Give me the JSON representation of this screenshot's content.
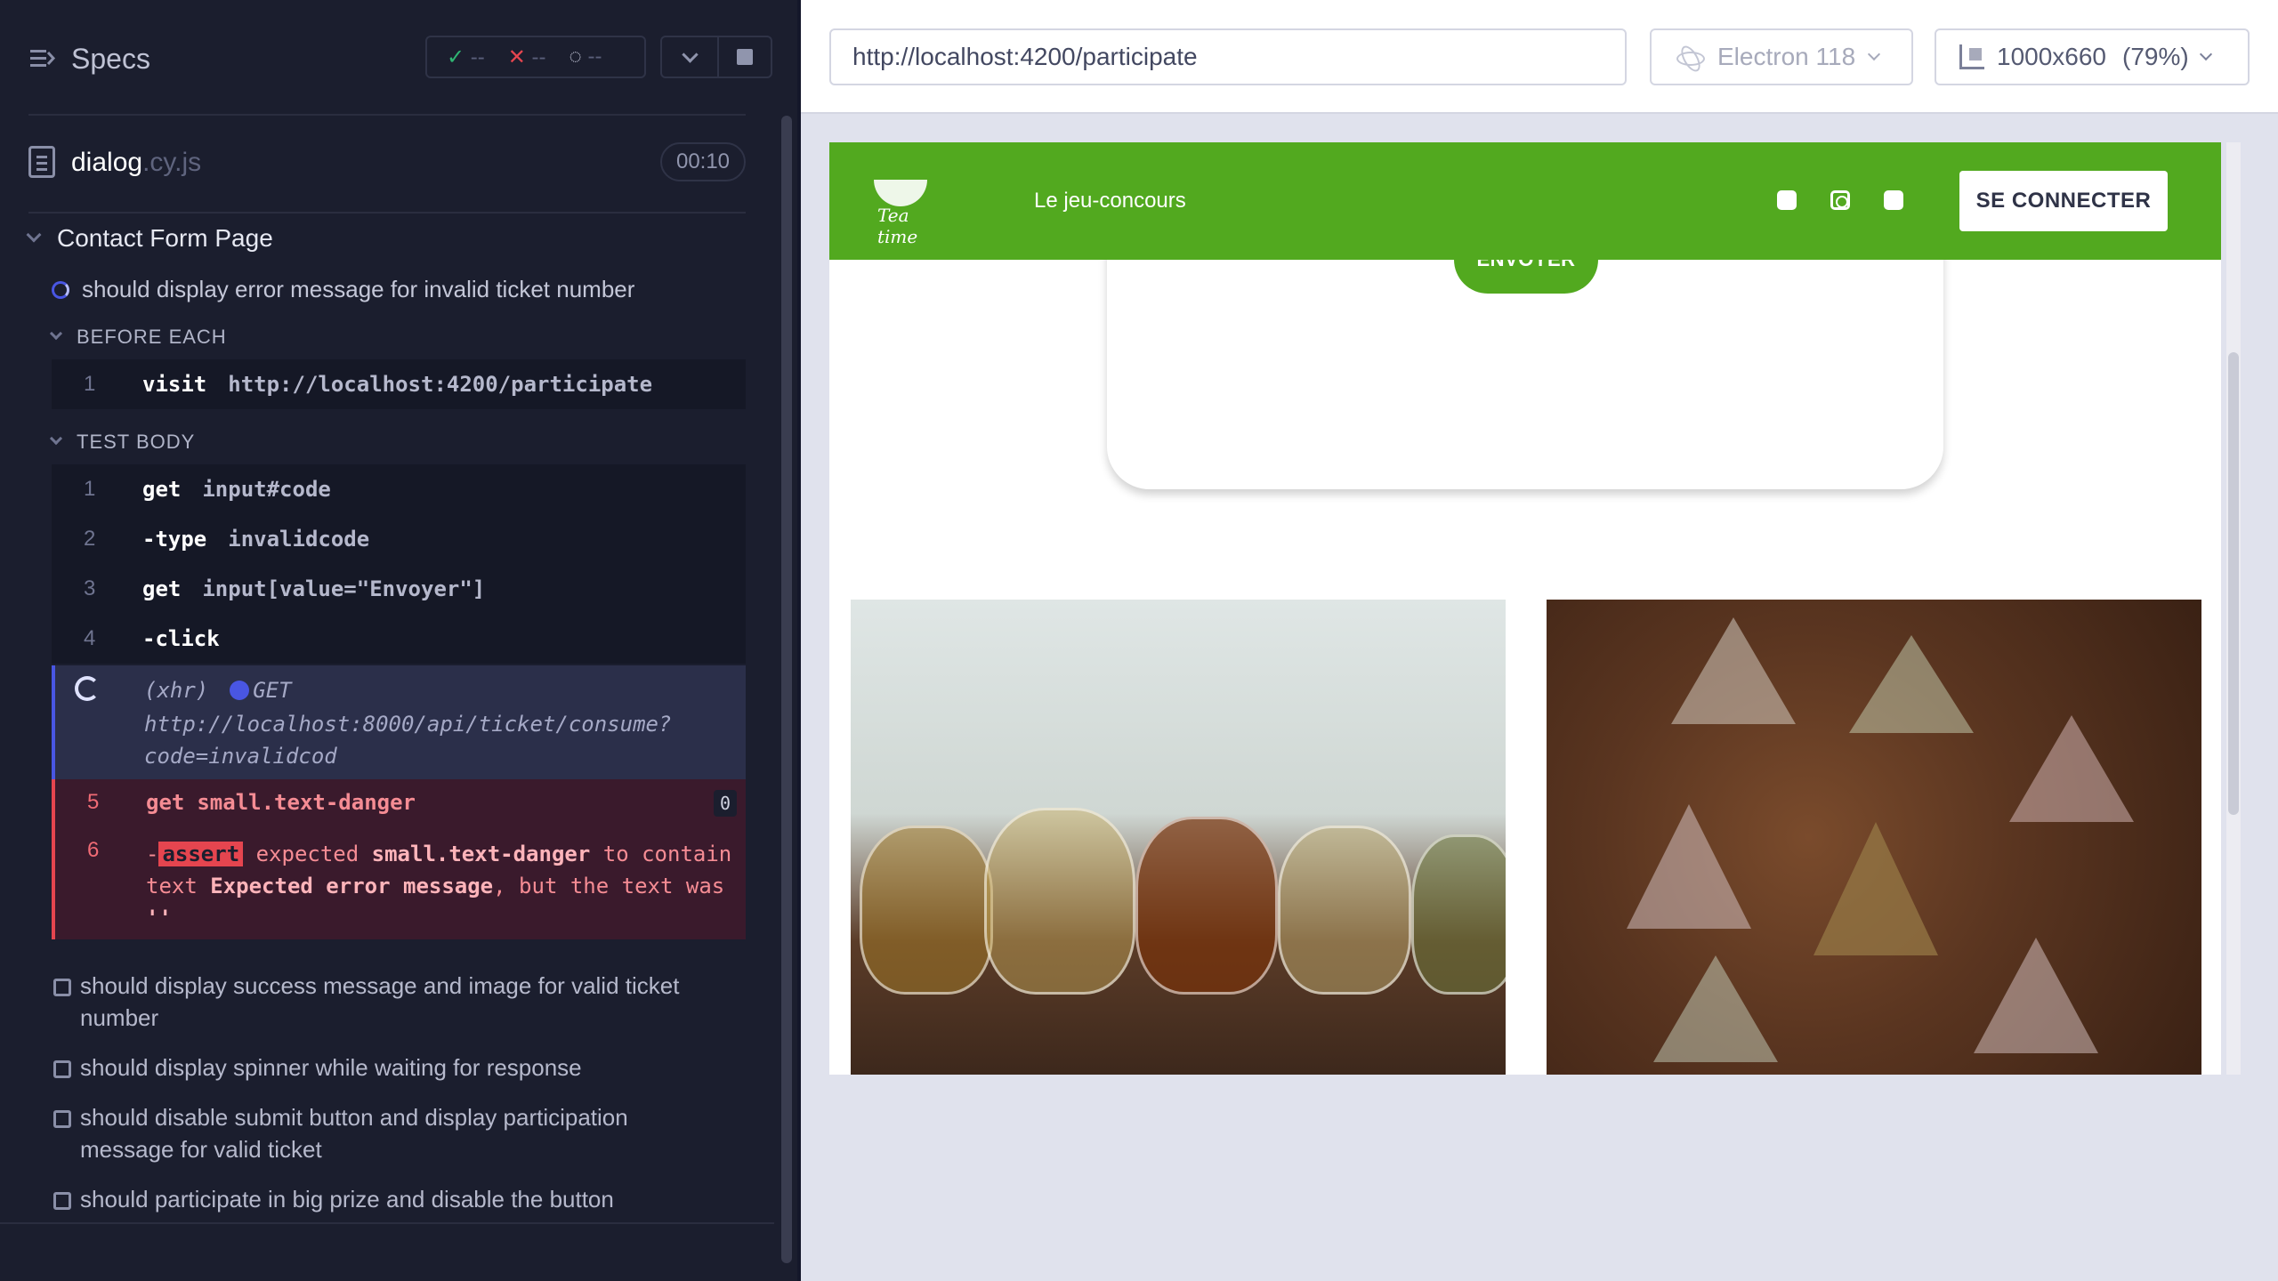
{
  "reporter": {
    "title": "Specs",
    "stats": {
      "passed": "--",
      "failed": "--",
      "pending": "--"
    },
    "file": {
      "name": "dialog",
      "ext": ".cy.js",
      "duration": "00:10"
    },
    "suite": "Contact Form Page",
    "active_test": "should display error message for invalid ticket number",
    "before_each_label": "BEFORE EACH",
    "before_each": [
      {
        "num": "1",
        "name": "visit",
        "arg": "http://localhost:4200/participate"
      }
    ],
    "test_body_label": "TEST BODY",
    "commands": [
      {
        "num": "1",
        "name": "get",
        "arg": "input#code"
      },
      {
        "num": "2",
        "name": "type",
        "arg": "invalidcode"
      },
      {
        "num": "3",
        "name": "get",
        "arg": "input[value=\"Envoyer\"]"
      },
      {
        "num": "4",
        "name": "click",
        "arg": ""
      }
    ],
    "xhr": {
      "label": "(xhr)",
      "method": "GET",
      "url_1": "http://localhost:8000/api/ticket/consume?",
      "url_2": "code=invalidcod"
    },
    "failed_get": {
      "num": "5",
      "name": "get",
      "arg": "small.text-danger",
      "badge": "0"
    },
    "assert": {
      "num": "6",
      "tag": "assert",
      "w1": "expected",
      "sel": "small.text-danger",
      "w2": "to contain text",
      "expected": "Expected error message",
      "w3": ", but the text was",
      "actual": "''"
    },
    "pending_tests": [
      "should display success message and image for valid ticket number",
      "should display spinner while waiting for response",
      "should disable submit button and display participation message for valid ticket",
      "should participate in big prize and disable the button"
    ]
  },
  "aut": {
    "url": "http://localhost:4200/participate",
    "browser": "Electron 118",
    "viewport": "1000x660",
    "zoom": "(79%)"
  },
  "app": {
    "logo_text": "Tea time",
    "nav_link": "Le jeu-concours",
    "login": "SE CONNECTER",
    "send": "ENVOYER"
  },
  "colors": {
    "brand_green": "#52a91f",
    "fail_red": "#e5454f",
    "running_blue": "#4956e3"
  }
}
